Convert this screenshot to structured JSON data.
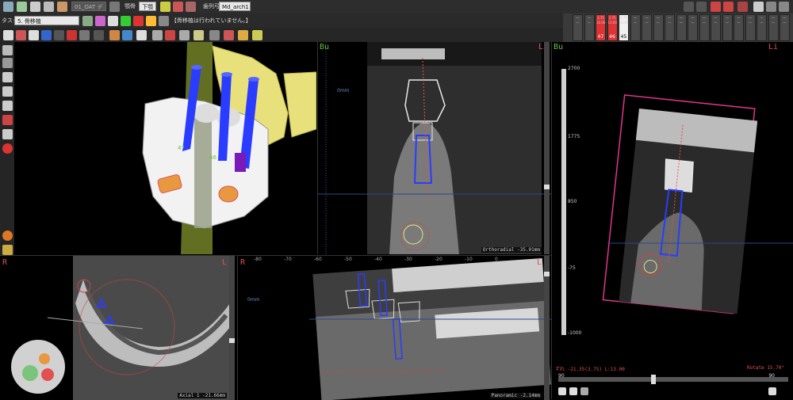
{
  "toolbar": {
    "project_field": "01_OAT デフォルト",
    "display_label": "顎骨",
    "jaw_select": "下顎",
    "tooth_row_label": "歯列弓",
    "arch_select": "Md_arch1",
    "task_label": "タスク",
    "task_select": "5. 骨移植",
    "task_status": "【骨移植は行われていません。】"
  },
  "tooth_chart": {
    "teeth": [
      {
        "num": "",
        "v1": "—",
        "v2": "—"
      },
      {
        "num": "",
        "v1": "—",
        "v2": "—"
      },
      {
        "num": "47",
        "v1": "3.75",
        "v2": "10.00"
      },
      {
        "num": "46",
        "v1": "3.75",
        "v2": "13.00"
      },
      {
        "num": "45",
        "v1": "3.75",
        "v2": "13.00"
      },
      {
        "num": "",
        "v1": "—",
        "v2": "—"
      },
      {
        "num": "",
        "v1": "—",
        "v2": "—"
      },
      {
        "num": "",
        "v1": "—",
        "v2": "—"
      },
      {
        "num": "",
        "v1": "—",
        "v2": "—"
      },
      {
        "num": "",
        "v1": "—",
        "v2": "—"
      },
      {
        "num": "",
        "v1": "—",
        "v2": "—"
      },
      {
        "num": "",
        "v1": "—",
        "v2": "—"
      },
      {
        "num": "",
        "v1": "—",
        "v2": "—"
      },
      {
        "num": "",
        "v1": "—",
        "v2": "—"
      },
      {
        "num": "",
        "v1": "—",
        "v2": "—"
      },
      {
        "num": "",
        "v1": "—",
        "v2": "—"
      },
      {
        "num": "",
        "v1": "—",
        "v2": "—"
      },
      {
        "num": "",
        "v1": "—",
        "v2": "—"
      },
      {
        "num": "",
        "v1": "—",
        "v2": "—"
      }
    ]
  },
  "views": {
    "model3d": {
      "label_47": "47",
      "label_46": "46"
    },
    "cross": {
      "left": "Bu",
      "right": "Li",
      "caption": "Orthoradial -35.01mm",
      "scale_mark": "0mm"
    },
    "side3d": {
      "left": "Bu",
      "right": "Li",
      "caption": "Rotate 15.70°",
      "info": "ずれ -21.35(3.75)  L:13.00"
    },
    "axial": {
      "left": "R",
      "right": "L",
      "caption": "Axial 1 -21.66mm"
    },
    "panoramic": {
      "left": "R",
      "right": "L",
      "caption": "Panoramic -2.14mm",
      "scale_mark": "0mm",
      "ruler": [
        "-80",
        "-70",
        "-60",
        "-50",
        "-40",
        "-30",
        "-20",
        "-10",
        "0"
      ]
    },
    "density_scale": {
      "top": "2700",
      "t1": "1775",
      "t2": "850",
      "t3": "-75",
      "bottom": "-1000"
    },
    "slider": {
      "min": "90",
      "max": "90"
    }
  },
  "colors": {
    "accent_red": "#d33333",
    "implant_blue": "#2a3cff",
    "bone_yellow": "#e8e07a",
    "bu_green": "#6bbf3a"
  }
}
